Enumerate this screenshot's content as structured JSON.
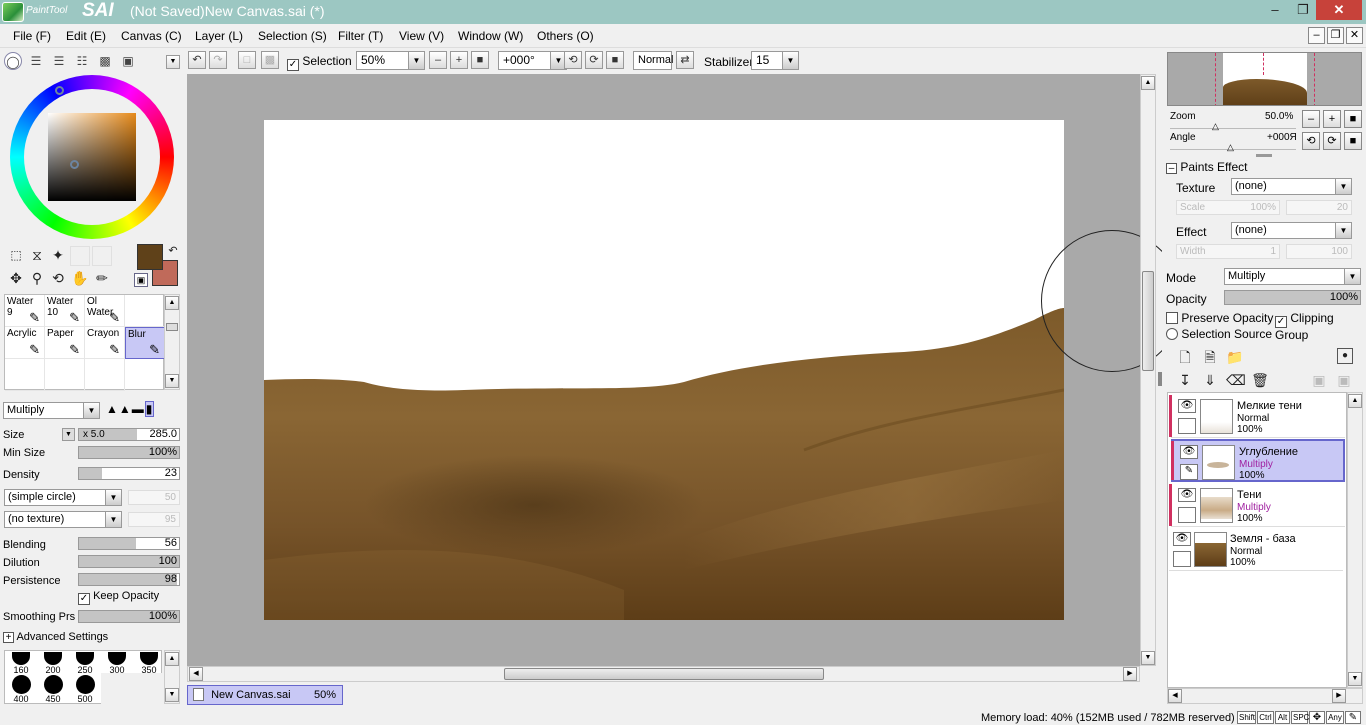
{
  "app": {
    "logo_small": "PaintTool",
    "logo_big": "SAI",
    "title": "(Not Saved)New Canvas.sai (*)"
  },
  "menu": [
    "File (F)",
    "Edit (E)",
    "Canvas (C)",
    "Layer (L)",
    "Selection (S)",
    "Filter (T)",
    "View (V)",
    "Window (W)",
    "Others (O)"
  ],
  "toolbar": {
    "selection_label": "Selection",
    "zoom": "50%",
    "angle": "+000°",
    "blend": "Normal",
    "stabilizer_label": "Stabilizer",
    "stabilizer_value": "15"
  },
  "colors": {
    "foreground": "#5f4119",
    "background": "#c06a5a",
    "selection": "#c8c8f5",
    "layer_mark": "#d03060"
  },
  "brushes": [
    {
      "name": "Water",
      "num": "9",
      "icon": "pen-icon"
    },
    {
      "name": "Water",
      "num": "10",
      "icon": "pen-icon"
    },
    {
      "name": "Ol Water",
      "num": "",
      "icon": "pen-icon"
    },
    {
      "name": "Acrylic",
      "num": "",
      "icon": "pen-icon"
    },
    {
      "name": "Paper",
      "num": "",
      "icon": "pen-icon"
    },
    {
      "name": "Crayon",
      "num": "",
      "icon": "pen-icon"
    },
    {
      "name": "Blur",
      "num": "",
      "icon": "blur-icon",
      "selected": true
    }
  ],
  "brush_settings": {
    "blend_mode": "Multiply",
    "size_label": "Size",
    "size_mult": "x 5.0",
    "size_value": "285.0",
    "minsize_label": "Min Size",
    "minsize_value": "100%",
    "density_label": "Density",
    "density_value": "23",
    "shape": "(simple circle)",
    "shape_value": "50",
    "texture": "(no texture)",
    "texture_value": "95",
    "blending_label": "Blending",
    "blending_value": "56",
    "dilution_label": "Dilution",
    "dilution_value": "100",
    "persistence_label": "Persistence",
    "persistence_value": "98",
    "keep_opacity_label": "Keep Opacity",
    "smoothing_label": "Smoothing Prs",
    "smoothing_value": "100%",
    "advanced_label": "Advanced Settings"
  },
  "sizes": [
    "160",
    "200",
    "250",
    "300",
    "350",
    "400",
    "450",
    "500"
  ],
  "document_tab": {
    "name": "New Canvas.sai",
    "zoom": "50%"
  },
  "navigator": {
    "zoom_label": "Zoom",
    "zoom_value": "50.0%",
    "angle_label": "Angle",
    "angle_value": "+000Я"
  },
  "paint_effect": {
    "title": "Paints Effect",
    "texture_label": "Texture",
    "texture_value": "(none)",
    "scale_label": "Scale",
    "scale_value": "100%",
    "scale_num": "20",
    "effect_label": "Effect",
    "effect_value": "(none)",
    "width_label": "Width",
    "width_value": "1",
    "width_num": "100"
  },
  "layer_props": {
    "mode_label": "Mode",
    "mode_value": "Multiply",
    "opacity_label": "Opacity",
    "opacity_value": "100%",
    "preserve_label": "Preserve Opacity",
    "clipping_label": "Clipping Group",
    "selection_source_label": "Selection Source"
  },
  "layers": [
    {
      "name": "Мелкие тени",
      "mode": "Normal",
      "opacity": "100%",
      "selected": false,
      "clipped": true
    },
    {
      "name": "Углубление",
      "mode": "Multiply",
      "opacity": "100%",
      "selected": true,
      "clipped": true
    },
    {
      "name": "Тени",
      "mode": "Multiply",
      "opacity": "100%",
      "selected": false,
      "clipped": true
    },
    {
      "name": "Земля - база",
      "mode": "Normal",
      "opacity": "100%",
      "selected": false,
      "clipped": false
    }
  ],
  "status": {
    "memory": "Memory load: 40% (152MB used / 782MB reserved)",
    "keys": [
      "Shift",
      "Ctrl",
      "Alt",
      "SPC",
      "Any"
    ]
  }
}
